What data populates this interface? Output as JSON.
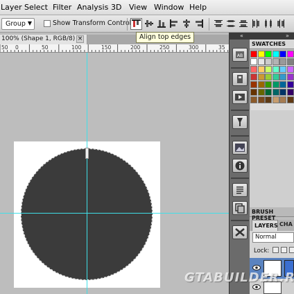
{
  "menu": {
    "items": [
      {
        "label": "Layer",
        "x_hint": "layer"
      },
      {
        "label": "Select"
      },
      {
        "label": "Filter"
      },
      {
        "label": "Analysis"
      },
      {
        "label": "3D"
      },
      {
        "label": "View"
      },
      {
        "label": "Window"
      },
      {
        "label": "Help"
      }
    ]
  },
  "options_bar": {
    "auto_select_value": "Group",
    "show_transform_label": "Show Transform Controls",
    "show_transform_checked": false
  },
  "tooltip": "Align top edges",
  "document": {
    "tab_title": "100% (Shape 1, RGB/8) *",
    "close_glyph": "×",
    "ruler_labels": [
      "50",
      "0",
      "50",
      "100",
      "150",
      "200",
      "250",
      "300",
      "35"
    ]
  },
  "panels": {
    "dock_collapse": "«",
    "dock_collapse_right": "»",
    "swatches_title": "SWATCHES",
    "brush_presets_title": "BRUSH PRESET",
    "layers_title": "LAYERS",
    "channels_title": "CHA",
    "blend_mode": "Normal",
    "lock_label": "Lock:"
  },
  "swatches": [
    [
      "#ff0000",
      "#ffff00",
      "#00ff00",
      "#00ffff",
      "#0000ff",
      "#ff00ff"
    ],
    [
      "#ffffff",
      "#e6e6e6",
      "#cccccc",
      "#b3b3b3",
      "#999999",
      "#808080"
    ],
    [
      "#ff6666",
      "#ffcc66",
      "#ccff66",
      "#66ffcc",
      "#66ccff",
      "#cc66ff"
    ],
    [
      "#cc3333",
      "#cc9933",
      "#99cc33",
      "#33cc99",
      "#3399cc",
      "#9933cc"
    ],
    [
      "#993300",
      "#996600",
      "#339900",
      "#009966",
      "#006699",
      "#330099"
    ],
    [
      "#663300",
      "#666600",
      "#006633",
      "#006666",
      "#003366",
      "#330066"
    ],
    [
      "#8c5a2a",
      "#7a4a1e",
      "#5e3a14",
      "#c69c6d",
      "#a67c52",
      "#603913"
    ]
  ],
  "colors": {
    "shape_fill": "#3b3b3b",
    "guide": "#3fe0e8",
    "layer_selected": "#5a83c0"
  },
  "watermark": "GTABUILDER.RU",
  "icons": [
    "layer-comps-icon",
    "history-icon",
    "actions-icon",
    "tool-presets-icon",
    "navigator-icon",
    "info-icon",
    "paragraph-icon",
    "clone-source-icon",
    "tools-icon"
  ]
}
